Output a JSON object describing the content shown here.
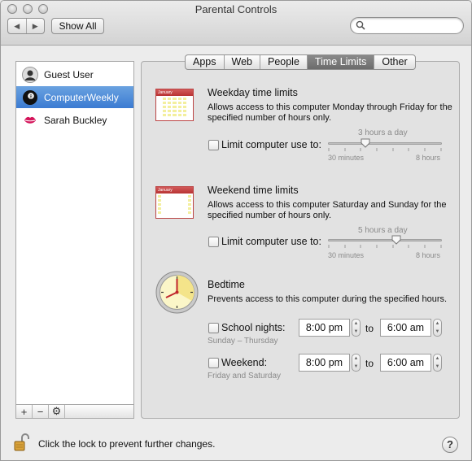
{
  "window": {
    "title": "Parental Controls"
  },
  "toolbar": {
    "back_label": "◀",
    "forward_label": "▶",
    "show_all_label": "Show All",
    "search_placeholder": ""
  },
  "users": [
    {
      "name": "Guest User",
      "icon": "person-silhouette-icon"
    },
    {
      "name": "ComputerWeekly",
      "icon": "eight-ball-icon",
      "selected": true
    },
    {
      "name": "Sarah Buckley",
      "icon": "lips-icon"
    }
  ],
  "sidebar_buttons": {
    "add": "+",
    "remove": "−",
    "action": "⚙"
  },
  "tabs": [
    "Apps",
    "Web",
    "People",
    "Time Limits",
    "Other"
  ],
  "active_tab": "Time Limits",
  "weekday": {
    "title": "Weekday time limits",
    "description": "Allows access to this computer Monday through Friday for the specified number of hours only.",
    "checkbox_label": "Limit computer use to:",
    "value_label": "3 hours a day",
    "min_label": "30 minutes",
    "max_label": "8 hours",
    "calendar_header": "January",
    "level": 0.33
  },
  "weekend": {
    "title": "Weekend time limits",
    "description": "Allows access to this computer Saturday and Sunday for the specified number of hours only.",
    "checkbox_label": "Limit computer use to:",
    "value_label": "5 hours a day",
    "min_label": "30 minutes",
    "max_label": "8 hours",
    "calendar_header": "January",
    "level": 0.6
  },
  "bedtime": {
    "title": "Bedtime",
    "description": "Prevents access to this computer during the specified hours.",
    "school_label": "School nights:",
    "school_sub": "Sunday – Thursday",
    "school_from": "8:00 pm",
    "school_to": "6:00 am",
    "weekend_label": "Weekend:",
    "weekend_sub": "Friday and Saturday",
    "weekend_from": "8:00 pm",
    "weekend_to": "6:00 am",
    "to_label": "to"
  },
  "footer": {
    "lock_text": "Click the lock to prevent further changes.",
    "help_label": "?"
  },
  "colors": {
    "selection": "#3b7bd2",
    "active_tab": "#777777"
  }
}
